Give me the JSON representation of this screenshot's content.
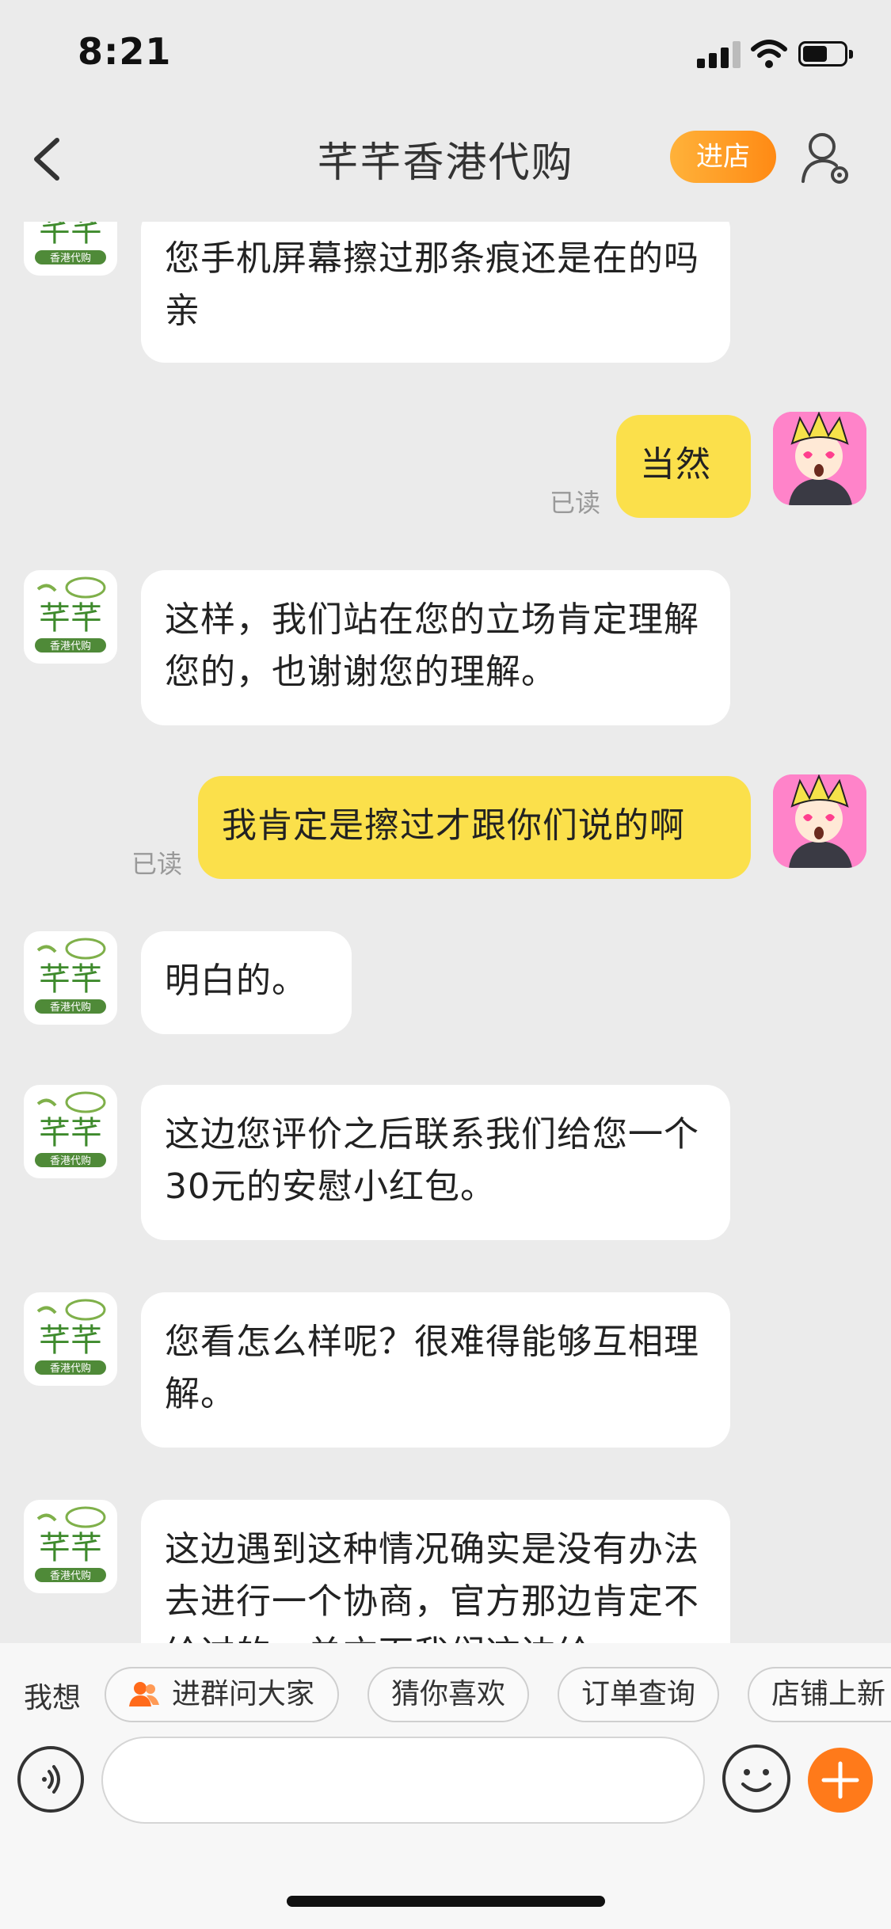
{
  "status_bar": {
    "time": "8:21"
  },
  "header": {
    "title": "芊芊香港代购",
    "enter_shop_label": "进店"
  },
  "shop_logo": {
    "name": "芊芊",
    "subtitle": "香港代购"
  },
  "messages": [
    {
      "from": "shop",
      "text": "您手机屏幕擦过那条痕还是在的吗亲"
    },
    {
      "from": "me",
      "text": "当然",
      "status": "已读"
    },
    {
      "from": "shop",
      "text": "这样，我们站在您的立场肯定理解您的，也谢谢您的理解。"
    },
    {
      "from": "me",
      "text": "我肯定是擦过才跟你们说的啊",
      "status": "已读"
    },
    {
      "from": "shop",
      "text": "明白的。"
    },
    {
      "from": "shop",
      "text": "这边您评价之后联系我们给您一个30元的安慰小红包。"
    },
    {
      "from": "shop",
      "text": "您看怎么样呢？很难得能够互相理解。"
    },
    {
      "from": "shop",
      "text": "这边遇到这种情况确实是没有办法去进行一个协商，官方那边肯定不给过的，单方面我们这边给"
    }
  ],
  "quick_actions": {
    "label": "我想",
    "items": [
      "进群问大家",
      "猜你喜欢",
      "订单查询",
      "店铺上新"
    ]
  },
  "input": {
    "placeholder": ""
  },
  "colors": {
    "accent": "#ff8a14",
    "my_bubble": "#fbe04b",
    "their_bubble": "#ffffff",
    "background": "#ebebeb"
  }
}
